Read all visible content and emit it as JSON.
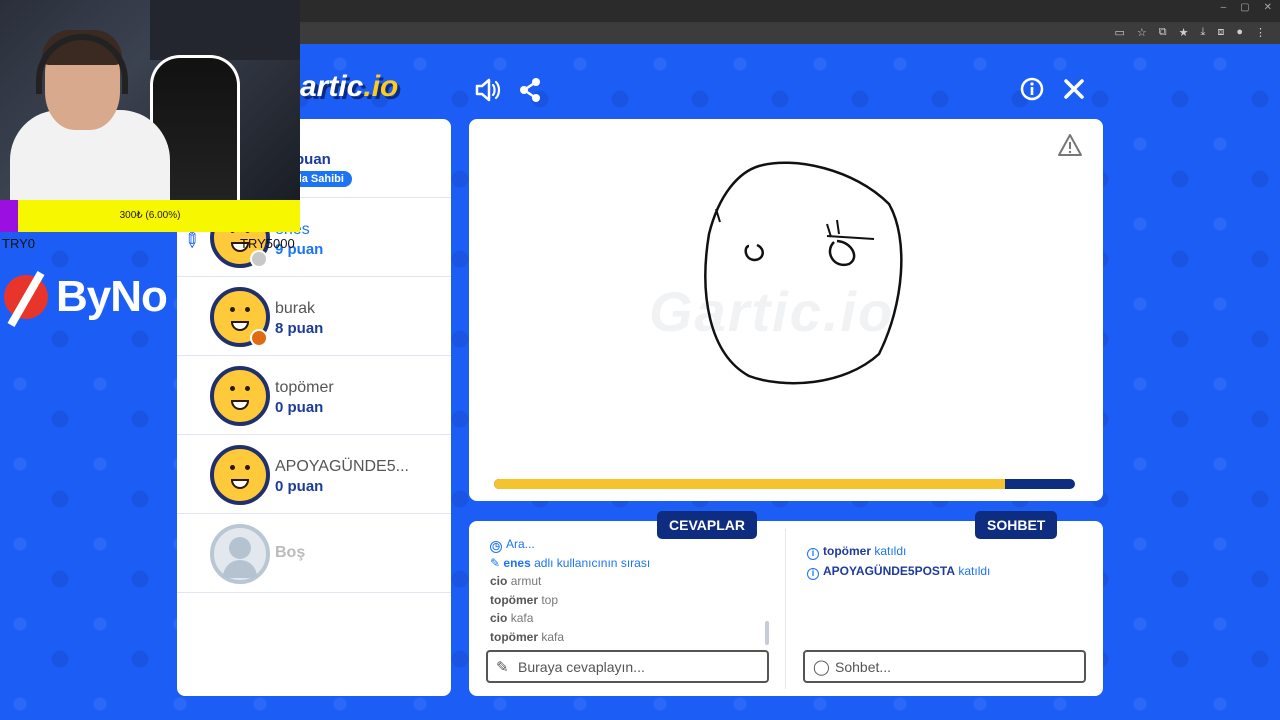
{
  "browser": {
    "window_controls": [
      "–",
      "▢",
      "✕"
    ]
  },
  "stream": {
    "donation_text": "300₺ (6.00%)",
    "donation_progress": 0.06,
    "left_label": "TRY0",
    "right_label": "TRY5000",
    "brand": "ByNo"
  },
  "game": {
    "logo_main": "artic",
    "logo_ext": ".io",
    "watermark": "Gartic.io",
    "timer_progress": 0.88,
    "colors": {
      "accent": "#1c5ef5",
      "navy": "#0f2d80",
      "gold": "#f5c230"
    }
  },
  "players": [
    {
      "name": "",
      "score": "puan",
      "badge": "da Sahibi",
      "status_color": ""
    },
    {
      "name": "enes",
      "score": "9 puan",
      "status_color": "#c8c8c8"
    },
    {
      "name": "burak",
      "score": "8 puan",
      "status_color": "#e06b12"
    },
    {
      "name": "topömer",
      "score": "0 puan",
      "status_color": ""
    },
    {
      "name": "APOYAGÜNDE5...",
      "score": "0 puan",
      "status_color": ""
    }
  ],
  "empty_slot": {
    "name": "Boş"
  },
  "tabs": {
    "answers": "CEVAPLAR",
    "chat": "SOHBET"
  },
  "answers_log": [
    {
      "user": "",
      "text": "Ara..."
    },
    {
      "user": "enes",
      "text": "adlı kullanıcının sırası"
    },
    {
      "user": "cio",
      "text": "armut"
    },
    {
      "user": "topömer",
      "text": "top"
    },
    {
      "user": "cio",
      "text": "kafa"
    },
    {
      "user": "topömer",
      "text": "kafa"
    }
  ],
  "chat_log": [
    {
      "user": "topömer",
      "text": "katıldı"
    },
    {
      "user": "APOYAGÜNDE5POSTA",
      "text": "katıldı"
    }
  ],
  "inputs": {
    "answer_placeholder": "Buraya cevaplayın...",
    "chat_placeholder": "Sohbet..."
  }
}
